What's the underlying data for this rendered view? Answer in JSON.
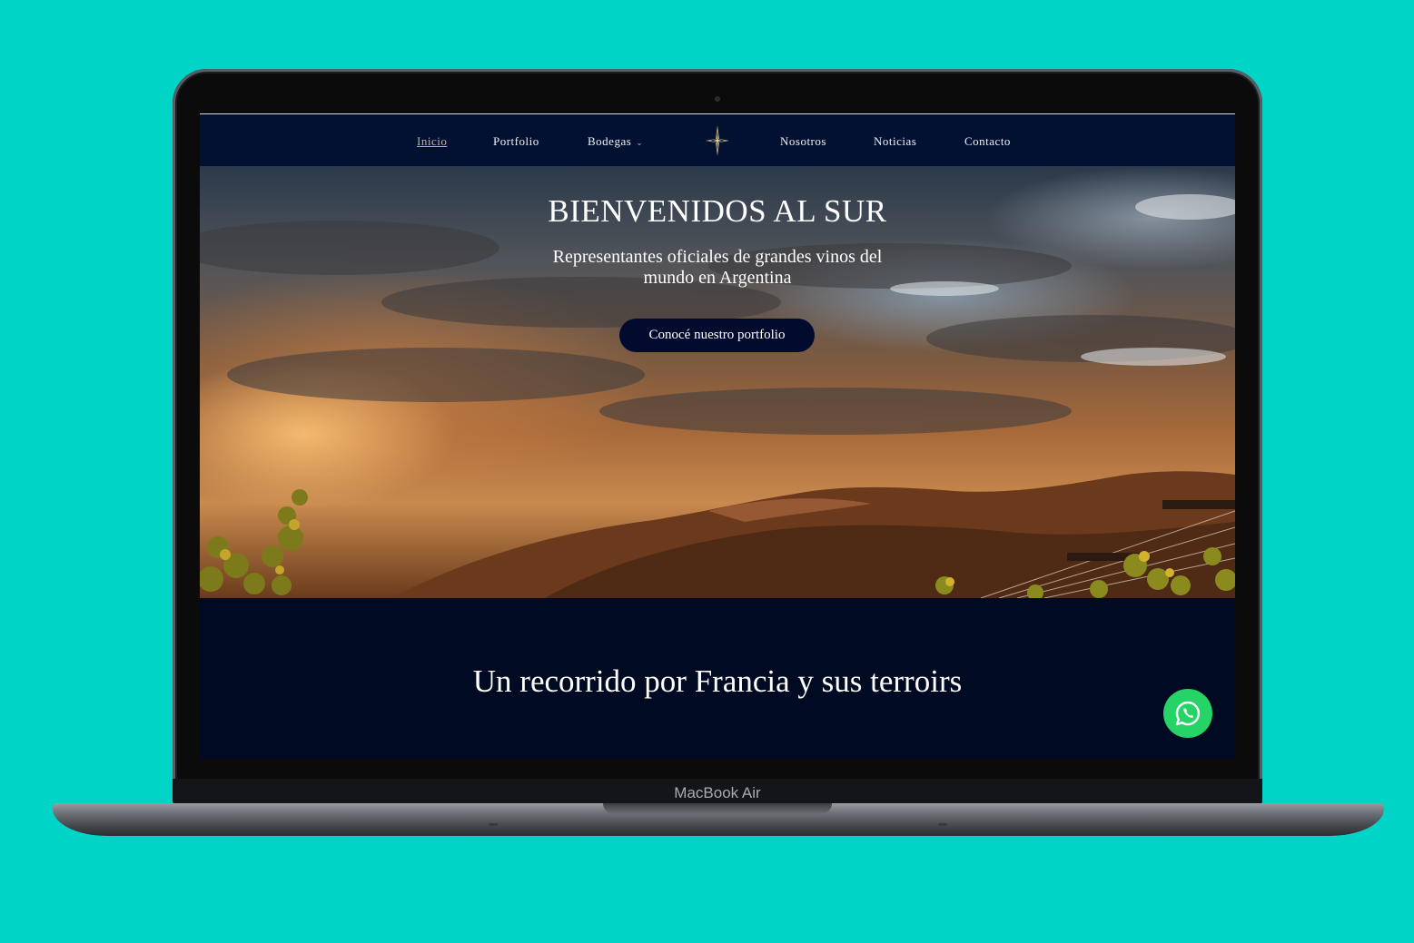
{
  "device": {
    "label": "MacBook Air"
  },
  "nav": {
    "items": [
      {
        "label": "Inicio",
        "active": true
      },
      {
        "label": "Portfolio"
      },
      {
        "label": "Bodegas",
        "has_dropdown": true
      },
      {
        "label": "Nosotros"
      },
      {
        "label": "Noticias"
      },
      {
        "label": "Contacto"
      }
    ],
    "logo_icon": "compass-star-icon"
  },
  "hero": {
    "title": "BIENVENIDOS AL SUR",
    "subtitle": "Representantes oficiales de grandes vinos del mundo en Argentina",
    "cta_label": "Conocé nuestro portfolio"
  },
  "section": {
    "title": "Un recorrido por Francia y sus terroirs"
  },
  "floating": {
    "icon": "whatsapp-icon"
  },
  "colors": {
    "background": "#00d4c6",
    "navy": "#021032",
    "button": "#020b2e",
    "whatsapp": "#25d366"
  }
}
